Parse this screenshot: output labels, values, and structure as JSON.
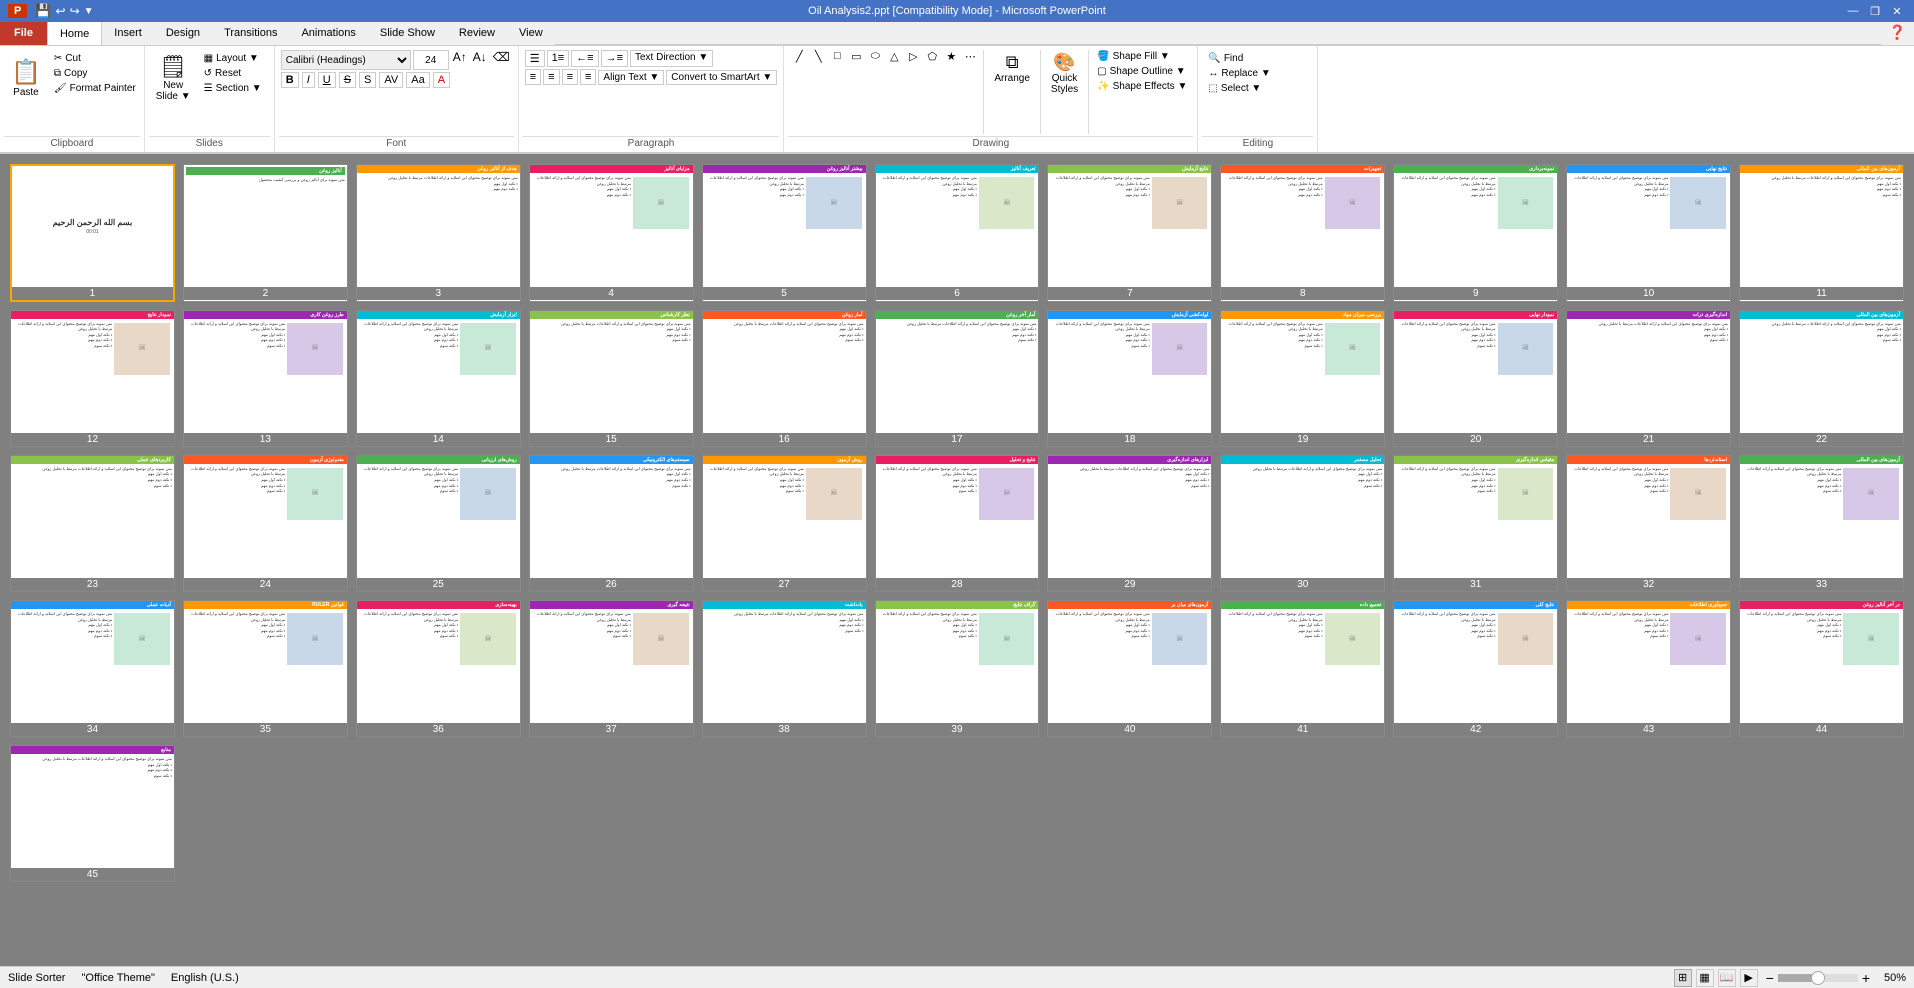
{
  "titleBar": {
    "title": "Oil Analysis2.ppt [Compatibility Mode] - Microsoft PowerPoint",
    "controls": [
      "—",
      "❐",
      "✕"
    ]
  },
  "quickAccess": [
    "💾",
    "↩",
    "↪"
  ],
  "ribbonTabs": [
    {
      "label": "File",
      "class": "file"
    },
    {
      "label": "Home",
      "class": "active"
    },
    {
      "label": "Insert",
      "class": ""
    },
    {
      "label": "Design",
      "class": ""
    },
    {
      "label": "Transitions",
      "class": ""
    },
    {
      "label": "Animations",
      "class": ""
    },
    {
      "label": "Slide Show",
      "class": ""
    },
    {
      "label": "Review",
      "class": ""
    },
    {
      "label": "View",
      "class": ""
    }
  ],
  "ribbon": {
    "groups": [
      {
        "label": "Clipboard",
        "items": [
          "Paste",
          "Cut",
          "Copy",
          "Format Painter"
        ]
      },
      {
        "label": "Slides",
        "items": [
          "New Slide",
          "Layout",
          "Reset",
          "Section"
        ]
      },
      {
        "label": "Font",
        "items": []
      },
      {
        "label": "Paragraph",
        "items": [
          "Text Direction",
          "Align Text",
          "Convert to SmartArt"
        ]
      },
      {
        "label": "Drawing",
        "items": [
          "Arrange",
          "Quick Styles",
          "Shape Fill",
          "Shape Outline",
          "Shape Effects"
        ]
      },
      {
        "label": "Editing",
        "items": [
          "Find",
          "Replace",
          "Select"
        ]
      }
    ]
  },
  "slides": [
    {
      "num": 1,
      "type": "title",
      "selected": true
    },
    {
      "num": 2,
      "type": "content"
    },
    {
      "num": 3,
      "type": "content"
    },
    {
      "num": 4,
      "type": "content"
    },
    {
      "num": 5,
      "type": "content"
    },
    {
      "num": 6,
      "type": "content"
    },
    {
      "num": 7,
      "type": "content"
    },
    {
      "num": 8,
      "type": "content"
    },
    {
      "num": 9,
      "type": "content"
    },
    {
      "num": 10,
      "type": "content"
    },
    {
      "num": 11,
      "type": "content"
    },
    {
      "num": 12,
      "type": "content"
    },
    {
      "num": 13,
      "type": "content"
    },
    {
      "num": 14,
      "type": "content"
    },
    {
      "num": 15,
      "type": "content"
    },
    {
      "num": 16,
      "type": "content"
    },
    {
      "num": 17,
      "type": "content"
    },
    {
      "num": 18,
      "type": "content"
    },
    {
      "num": 19,
      "type": "content"
    },
    {
      "num": 20,
      "type": "content"
    },
    {
      "num": 21,
      "type": "content"
    },
    {
      "num": 22,
      "type": "content"
    },
    {
      "num": 23,
      "type": "content"
    },
    {
      "num": 24,
      "type": "content"
    },
    {
      "num": 25,
      "type": "content"
    },
    {
      "num": 26,
      "type": "content"
    },
    {
      "num": 27,
      "type": "content"
    },
    {
      "num": 28,
      "type": "content"
    },
    {
      "num": 29,
      "type": "content"
    },
    {
      "num": 30,
      "type": "content"
    },
    {
      "num": 31,
      "type": "content"
    },
    {
      "num": 32,
      "type": "content"
    },
    {
      "num": 33,
      "type": "content"
    },
    {
      "num": 34,
      "type": "content"
    },
    {
      "num": 35,
      "type": "content"
    },
    {
      "num": 36,
      "type": "content"
    },
    {
      "num": 37,
      "type": "content"
    },
    {
      "num": 38,
      "type": "content"
    },
    {
      "num": 39,
      "type": "content"
    },
    {
      "num": 40,
      "type": "content"
    },
    {
      "num": 41,
      "type": "content"
    },
    {
      "num": 42,
      "type": "content"
    },
    {
      "num": 43,
      "type": "content"
    },
    {
      "num": 44,
      "type": "content"
    },
    {
      "num": 45,
      "type": "last"
    }
  ],
  "statusBar": {
    "slideCount": "Slide Sorter",
    "theme": "\"Office Theme\"",
    "language": "English (U.S.)",
    "zoom": "50%",
    "viewButtons": [
      "normal",
      "slide-sorter",
      "reading",
      "slideshow"
    ]
  }
}
